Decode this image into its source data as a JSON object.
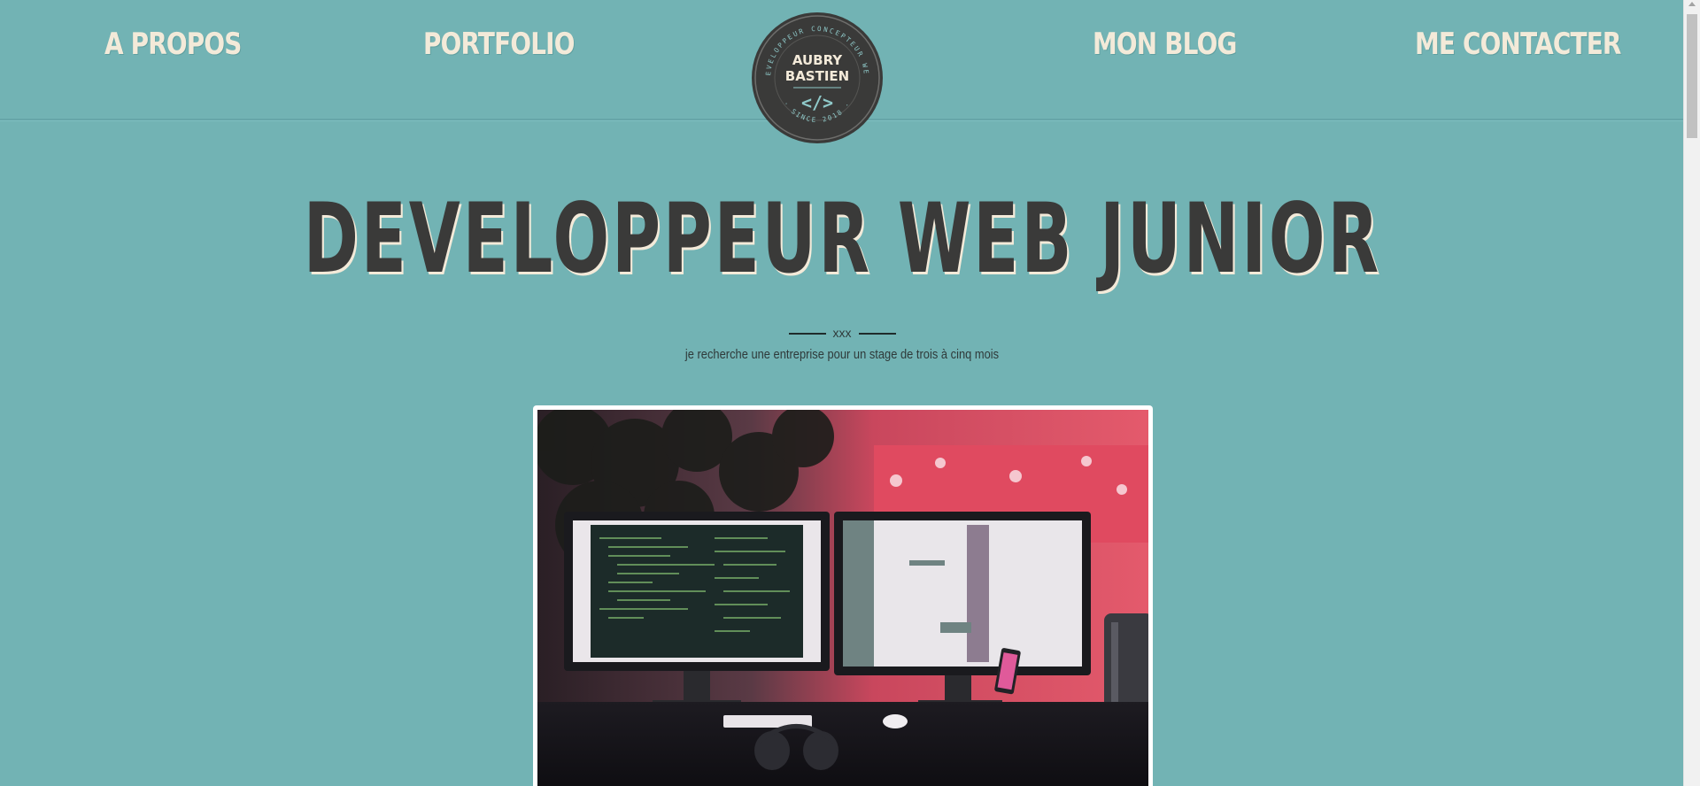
{
  "nav": {
    "items": [
      {
        "label": "A PROPOS"
      },
      {
        "label": "PORTFOLIO"
      },
      {
        "label": "MON BLOG"
      },
      {
        "label": "ME CONTACTER"
      }
    ],
    "logo": {
      "name_line1": "AUBRY",
      "name_line2": "BASTIEN",
      "arc_top": "DEVELOPPEUR CONCEPTEUR WEB",
      "arc_bottom": "· SINCE 2018 ·",
      "code_glyph": "</>"
    }
  },
  "hero": {
    "title": "DEVELOPPEUR WEB JUNIOR",
    "divider_text": "xxx",
    "subtitle": "je recherche une entreprise pour un stage de trois à cinq mois"
  },
  "colors": {
    "background": "#72b3b4",
    "nav_text": "#f3ead9",
    "title_text": "#3a3a39",
    "logo_bg": "#3a3a39"
  }
}
